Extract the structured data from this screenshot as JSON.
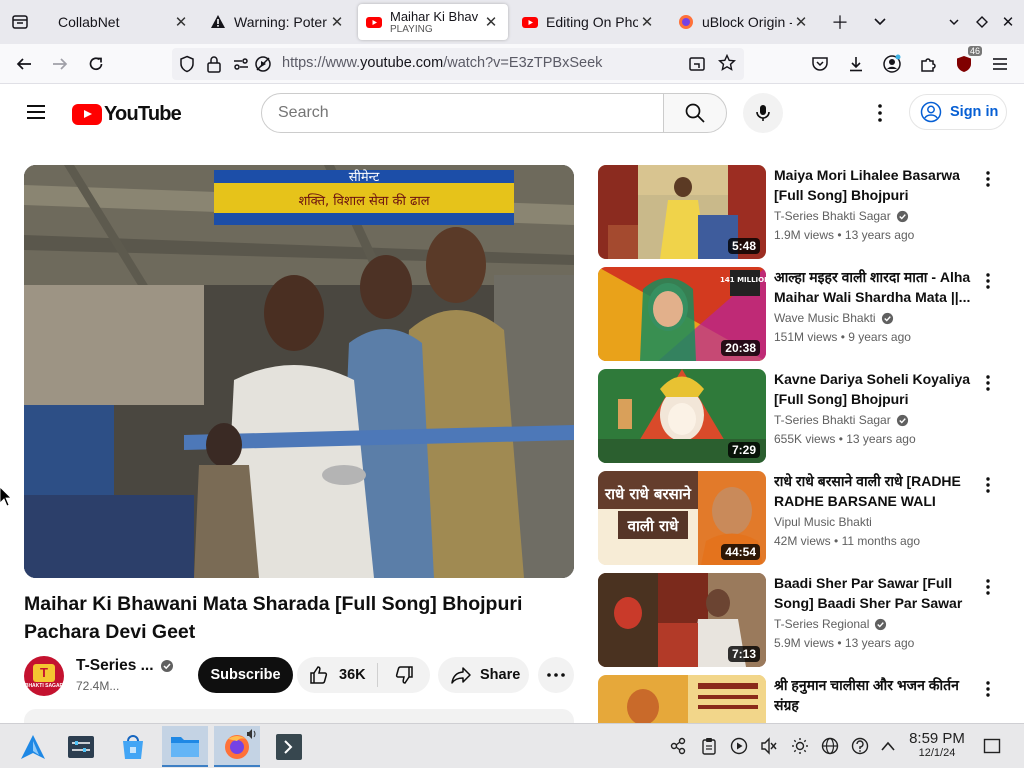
{
  "browser": {
    "tabs": [
      {
        "title": "CollabNet",
        "active": false
      },
      {
        "title": "Warning: Poter",
        "active": false
      },
      {
        "title": "Maihar Ki Bhav",
        "subtitle": "PLAYING",
        "active": true
      },
      {
        "title": "Editing On Pho",
        "active": false
      },
      {
        "title": "uBlock Origin -",
        "active": false
      }
    ],
    "url_prefix": "https://www.",
    "url_host": "youtube.com",
    "url_path": "/watch?v=E3zTPBxSeek",
    "extension_badge": "46"
  },
  "youtube": {
    "logo_text": "YouTube",
    "search_placeholder": "Search",
    "sign_in": "Sign in",
    "video": {
      "title": "Maihar Ki Bhawani Mata Sharada [Full Song] Bhojpuri Pachara Devi Geet",
      "channel": "T-Series ...",
      "subscribers": "72.4M...",
      "subscribe_label": "Subscribe",
      "likes": "36K",
      "share_label": "Share",
      "banner_text_top": "सीमेन्ट",
      "banner_text_bottom": "शक्ति, विशाल सेवा की ढाल",
      "avatar_text": "T",
      "avatar_subtext": "BHAKTI SAGAR"
    },
    "recommendations": [
      {
        "title": "Maiya Mori Lihalee Basarwa [Full Song] Bhojpuri Pachara...",
        "channel": "T-Series Bhakti Sagar",
        "verified": true,
        "views": "1.9M views",
        "age": "13 years ago",
        "duration": "5:48"
      },
      {
        "title": "आल्हा मइहर वाली शारदा माता - Alha Maihar Wali Shardha Mata ||...",
        "channel": "Wave Music Bhakti",
        "verified": true,
        "views": "151M views",
        "age": "9 years ago",
        "duration": "20:38"
      },
      {
        "title": "Kavne Dariya Soheli Koyaliya [Full Song] Bhojpuri Pachara...",
        "channel": "T-Series Bhakti Sagar",
        "verified": true,
        "views": "655K views",
        "age": "13 years ago",
        "duration": "7:29"
      },
      {
        "title": "राधे राधे बरसाने वाली राधे [RADHE RADHE BARSANE WALI RADH...",
        "channel": "Vipul Music Bhakti",
        "verified": false,
        "views": "42M views",
        "age": "11 months ago",
        "duration": "44:54"
      },
      {
        "title": "Baadi Sher Par Sawar [Full Song] Baadi Sher Par Sawar",
        "channel": "T-Series Regional",
        "verified": true,
        "views": "5.9M views",
        "age": "13 years ago",
        "duration": "7:13"
      },
      {
        "title": "श्री हनुमान चालीसा और भजन कीर्तन संग्रह",
        "channel": "",
        "verified": false,
        "views": "",
        "age": "",
        "duration": ""
      }
    ],
    "thumb_texts": {
      "r2_badge": "141 MILLION",
      "r4_line1": "राधे राधे बरसाने",
      "r4_line2": "वाली राधे"
    }
  },
  "taskbar": {
    "time": "8:59 PM",
    "date": "12/1/24"
  },
  "colors": {
    "youtube_red": "#ff0000",
    "link_blue": "#065fd4",
    "taskbar_active": "#c4d3e4"
  }
}
